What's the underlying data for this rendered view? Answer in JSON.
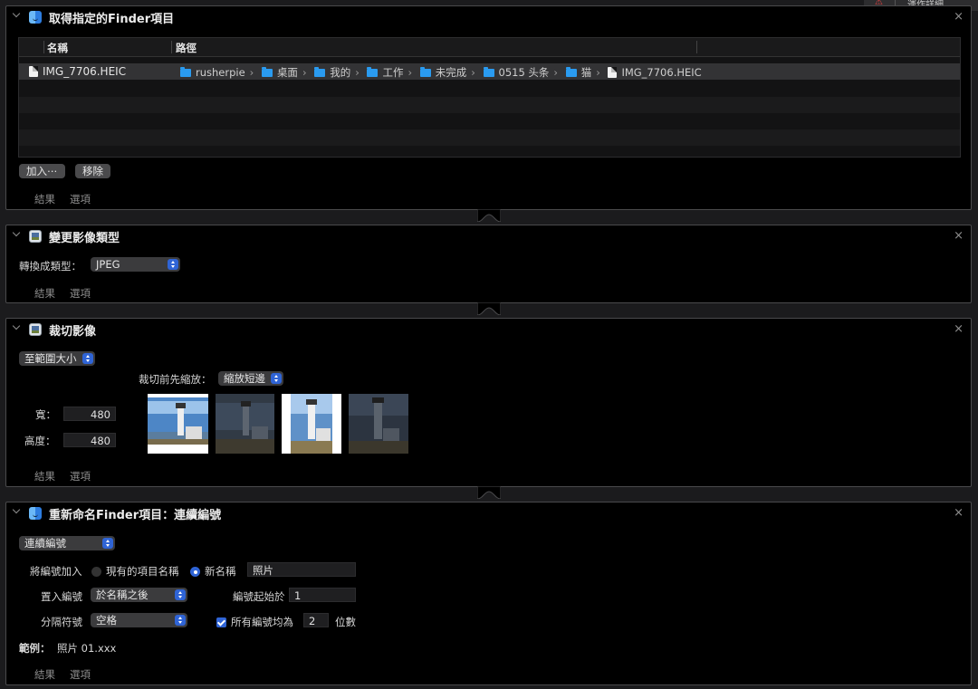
{
  "top_badge": {
    "text": "運作詳細"
  },
  "action1": {
    "title": "取得指定的Finder項目",
    "col_name": "名稱",
    "col_path": "路徑",
    "row": {
      "name": "IMG_7706.HEIC",
      "path": [
        "rusherpie",
        "桌面",
        "我的",
        "工作",
        "未完成",
        "0515 头条",
        "猫"
      ],
      "file": "IMG_7706.HEIC"
    },
    "add_button": "加入⋯",
    "remove_button": "移除",
    "footer_results": "結果",
    "footer_options": "選項"
  },
  "action2": {
    "title": "變更影像類型",
    "convert_label": "轉換成類型：",
    "convert_value": "JPEG",
    "footer_results": "結果",
    "footer_options": "選項"
  },
  "action3": {
    "title": "裁切影像",
    "mode_value": "至範圍大小",
    "prescale_label": "裁切前先縮放：",
    "prescale_value": "縮放短邊",
    "width_label": "寬：",
    "width_value": "480",
    "height_label": "高度：",
    "height_value": "480",
    "footer_results": "結果",
    "footer_options": "選項"
  },
  "action4": {
    "title": "重新命名Finder項目：連續編號",
    "mode_value": "連續編號",
    "add_number_label": "將編號加入",
    "radio_existing": "現有的項目名稱",
    "radio_new": "新名稱",
    "new_name_value": "照片",
    "place_label": "置入編號",
    "place_value": "於名稱之後",
    "start_label": "編號起始於",
    "start_value": "1",
    "separator_label": "分隔符號",
    "separator_value": "空格",
    "digits_check_label": "所有編號均為",
    "digits_value": "2",
    "digits_unit": "位數",
    "example_label": "範例：",
    "example_value": "照片 01.xxx",
    "footer_results": "結果",
    "footer_options": "選項"
  },
  "colors": {
    "accent": "#2f64d6",
    "folder": "#2a9bf0",
    "panel_bg": "#000000",
    "border": "#4a4a4c"
  }
}
